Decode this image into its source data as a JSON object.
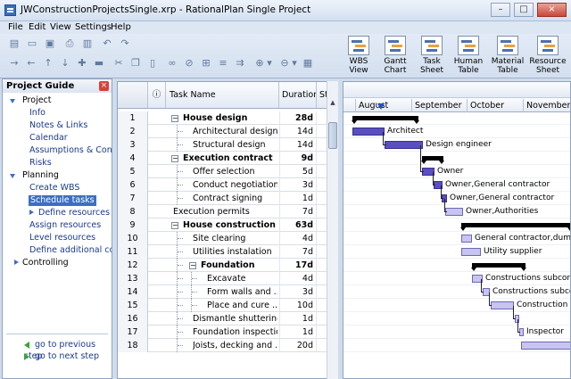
{
  "window": {
    "title": "JWConstructionProjectsSingle.xrp - RationalPlan Single Project",
    "controls": {
      "minimize": "–",
      "maximize": "□",
      "close": "×"
    }
  },
  "menu": [
    "File",
    "Edit",
    "View",
    "Settings",
    "Help"
  ],
  "toolbar": {
    "views": [
      {
        "label1": "WBS",
        "label2": "View",
        "icon": "wbs-view-icon"
      },
      {
        "label1": "Gantt",
        "label2": "Chart",
        "icon": "gantt-chart-icon"
      },
      {
        "label1": "Task",
        "label2": "Sheet",
        "icon": "task-sheet-icon"
      },
      {
        "label1": "Human",
        "label2": "Table",
        "icon": "human-table-icon"
      },
      {
        "label1": "Material",
        "label2": "Table",
        "icon": "material-table-icon"
      },
      {
        "label1": "Resource",
        "label2": "Sheet",
        "icon": "resource-sheet-icon"
      }
    ]
  },
  "guide": {
    "title": "Project Guide",
    "sections": [
      {
        "label": "Project",
        "items": [
          "Info",
          "Notes & Links",
          "Calendar",
          "Assumptions & Constra",
          "Risks"
        ]
      },
      {
        "label": "Planning",
        "items": [
          "Create WBS",
          "Schedule tasks",
          "Define resources",
          "Assign resources",
          "Level resources",
          "Define additional costs"
        ]
      },
      {
        "label": "Controlling",
        "items": []
      }
    ],
    "selected": "Schedule tasks",
    "prev": "go to previous step",
    "next": "go to next step"
  },
  "grid": {
    "columns": {
      "info": "ⓘ",
      "name": "Task Name",
      "duration": "Duration",
      "start": "St"
    },
    "rows": [
      {
        "n": "1",
        "name": "House design",
        "dur": "28d",
        "bold": true,
        "level": 0,
        "exp": "⊟"
      },
      {
        "n": "2",
        "name": "Architectural design",
        "dur": "14d",
        "bold": false,
        "level": 1
      },
      {
        "n": "3",
        "name": "Structural design",
        "dur": "14d",
        "bold": false,
        "level": 1
      },
      {
        "n": "4",
        "name": "Execution contract",
        "dur": "9d",
        "bold": true,
        "level": 0,
        "exp": "⊟"
      },
      {
        "n": "5",
        "name": "Offer selection",
        "dur": "5d",
        "bold": false,
        "level": 1
      },
      {
        "n": "6",
        "name": "Conduct negotiations",
        "dur": "3d",
        "bold": false,
        "level": 1
      },
      {
        "n": "7",
        "name": "Contract signing",
        "dur": "1d",
        "bold": false,
        "level": 1
      },
      {
        "n": "8",
        "name": "Execution permits",
        "dur": "7d",
        "bold": false,
        "level": 0
      },
      {
        "n": "9",
        "name": "House construction",
        "dur": "63d",
        "bold": true,
        "level": 0,
        "exp": "⊟"
      },
      {
        "n": "10",
        "name": "Site clearing",
        "dur": "4d",
        "bold": false,
        "level": 1
      },
      {
        "n": "11",
        "name": "Utilities instalation",
        "dur": "7d",
        "bold": false,
        "level": 1
      },
      {
        "n": "12",
        "name": "Foundation",
        "dur": "17d",
        "bold": true,
        "level": 1,
        "exp": "⊟"
      },
      {
        "n": "13",
        "name": "Excavate",
        "dur": "4d",
        "bold": false,
        "level": 2
      },
      {
        "n": "14",
        "name": "Form walls and ...",
        "dur": "3d",
        "bold": false,
        "level": 2
      },
      {
        "n": "15",
        "name": "Place and cure ...",
        "dur": "10d",
        "bold": false,
        "level": 2
      },
      {
        "n": "16",
        "name": "Dismantle shuttering",
        "dur": "1d",
        "bold": false,
        "level": 1
      },
      {
        "n": "17",
        "name": "Foundation inspection",
        "dur": "1d",
        "bold": false,
        "level": 1
      },
      {
        "n": "18",
        "name": "Joists, decking and ...",
        "dur": "20d",
        "bold": false,
        "level": 1
      }
    ]
  },
  "gantt": {
    "months": [
      "August",
      "September",
      "October",
      "November"
    ],
    "labels": {
      "2": "Architect",
      "3": "Design engineer",
      "5": "Owner",
      "6": "Owner,General contractor",
      "7": "Owner,General contractor",
      "8": "Owner,Authorities",
      "10": "General contractor,dump",
      "11": "Utility supplier",
      "13": "Constructions subcon",
      "14": "Constructions subcon",
      "15": "Construction",
      "17": "Inspector"
    },
    "colors": {
      "task": "#5a4fc0",
      "task_light": "#c7c4f0",
      "summary": "#000000",
      "today_marker": "#2355c8"
    }
  }
}
